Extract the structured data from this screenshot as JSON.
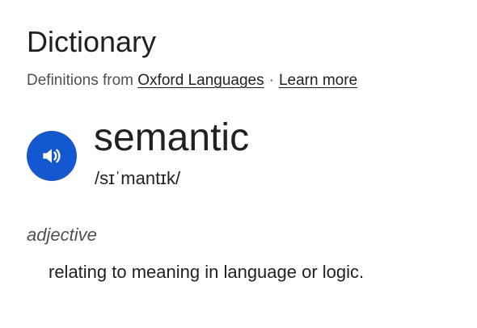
{
  "dictionary": {
    "title": "Dictionary",
    "source_prefix": "Definitions from",
    "source_link": "Oxford Languages",
    "separator": "·",
    "learn_more": "Learn more",
    "speaker_icon": "speaker-icon",
    "accent_color": "#1358d0"
  },
  "entry": {
    "word": "semantic",
    "phonetic": "/sɪˈmantɪk/",
    "part_of_speech": "adjective",
    "definition": "relating to meaning in language or logic."
  }
}
